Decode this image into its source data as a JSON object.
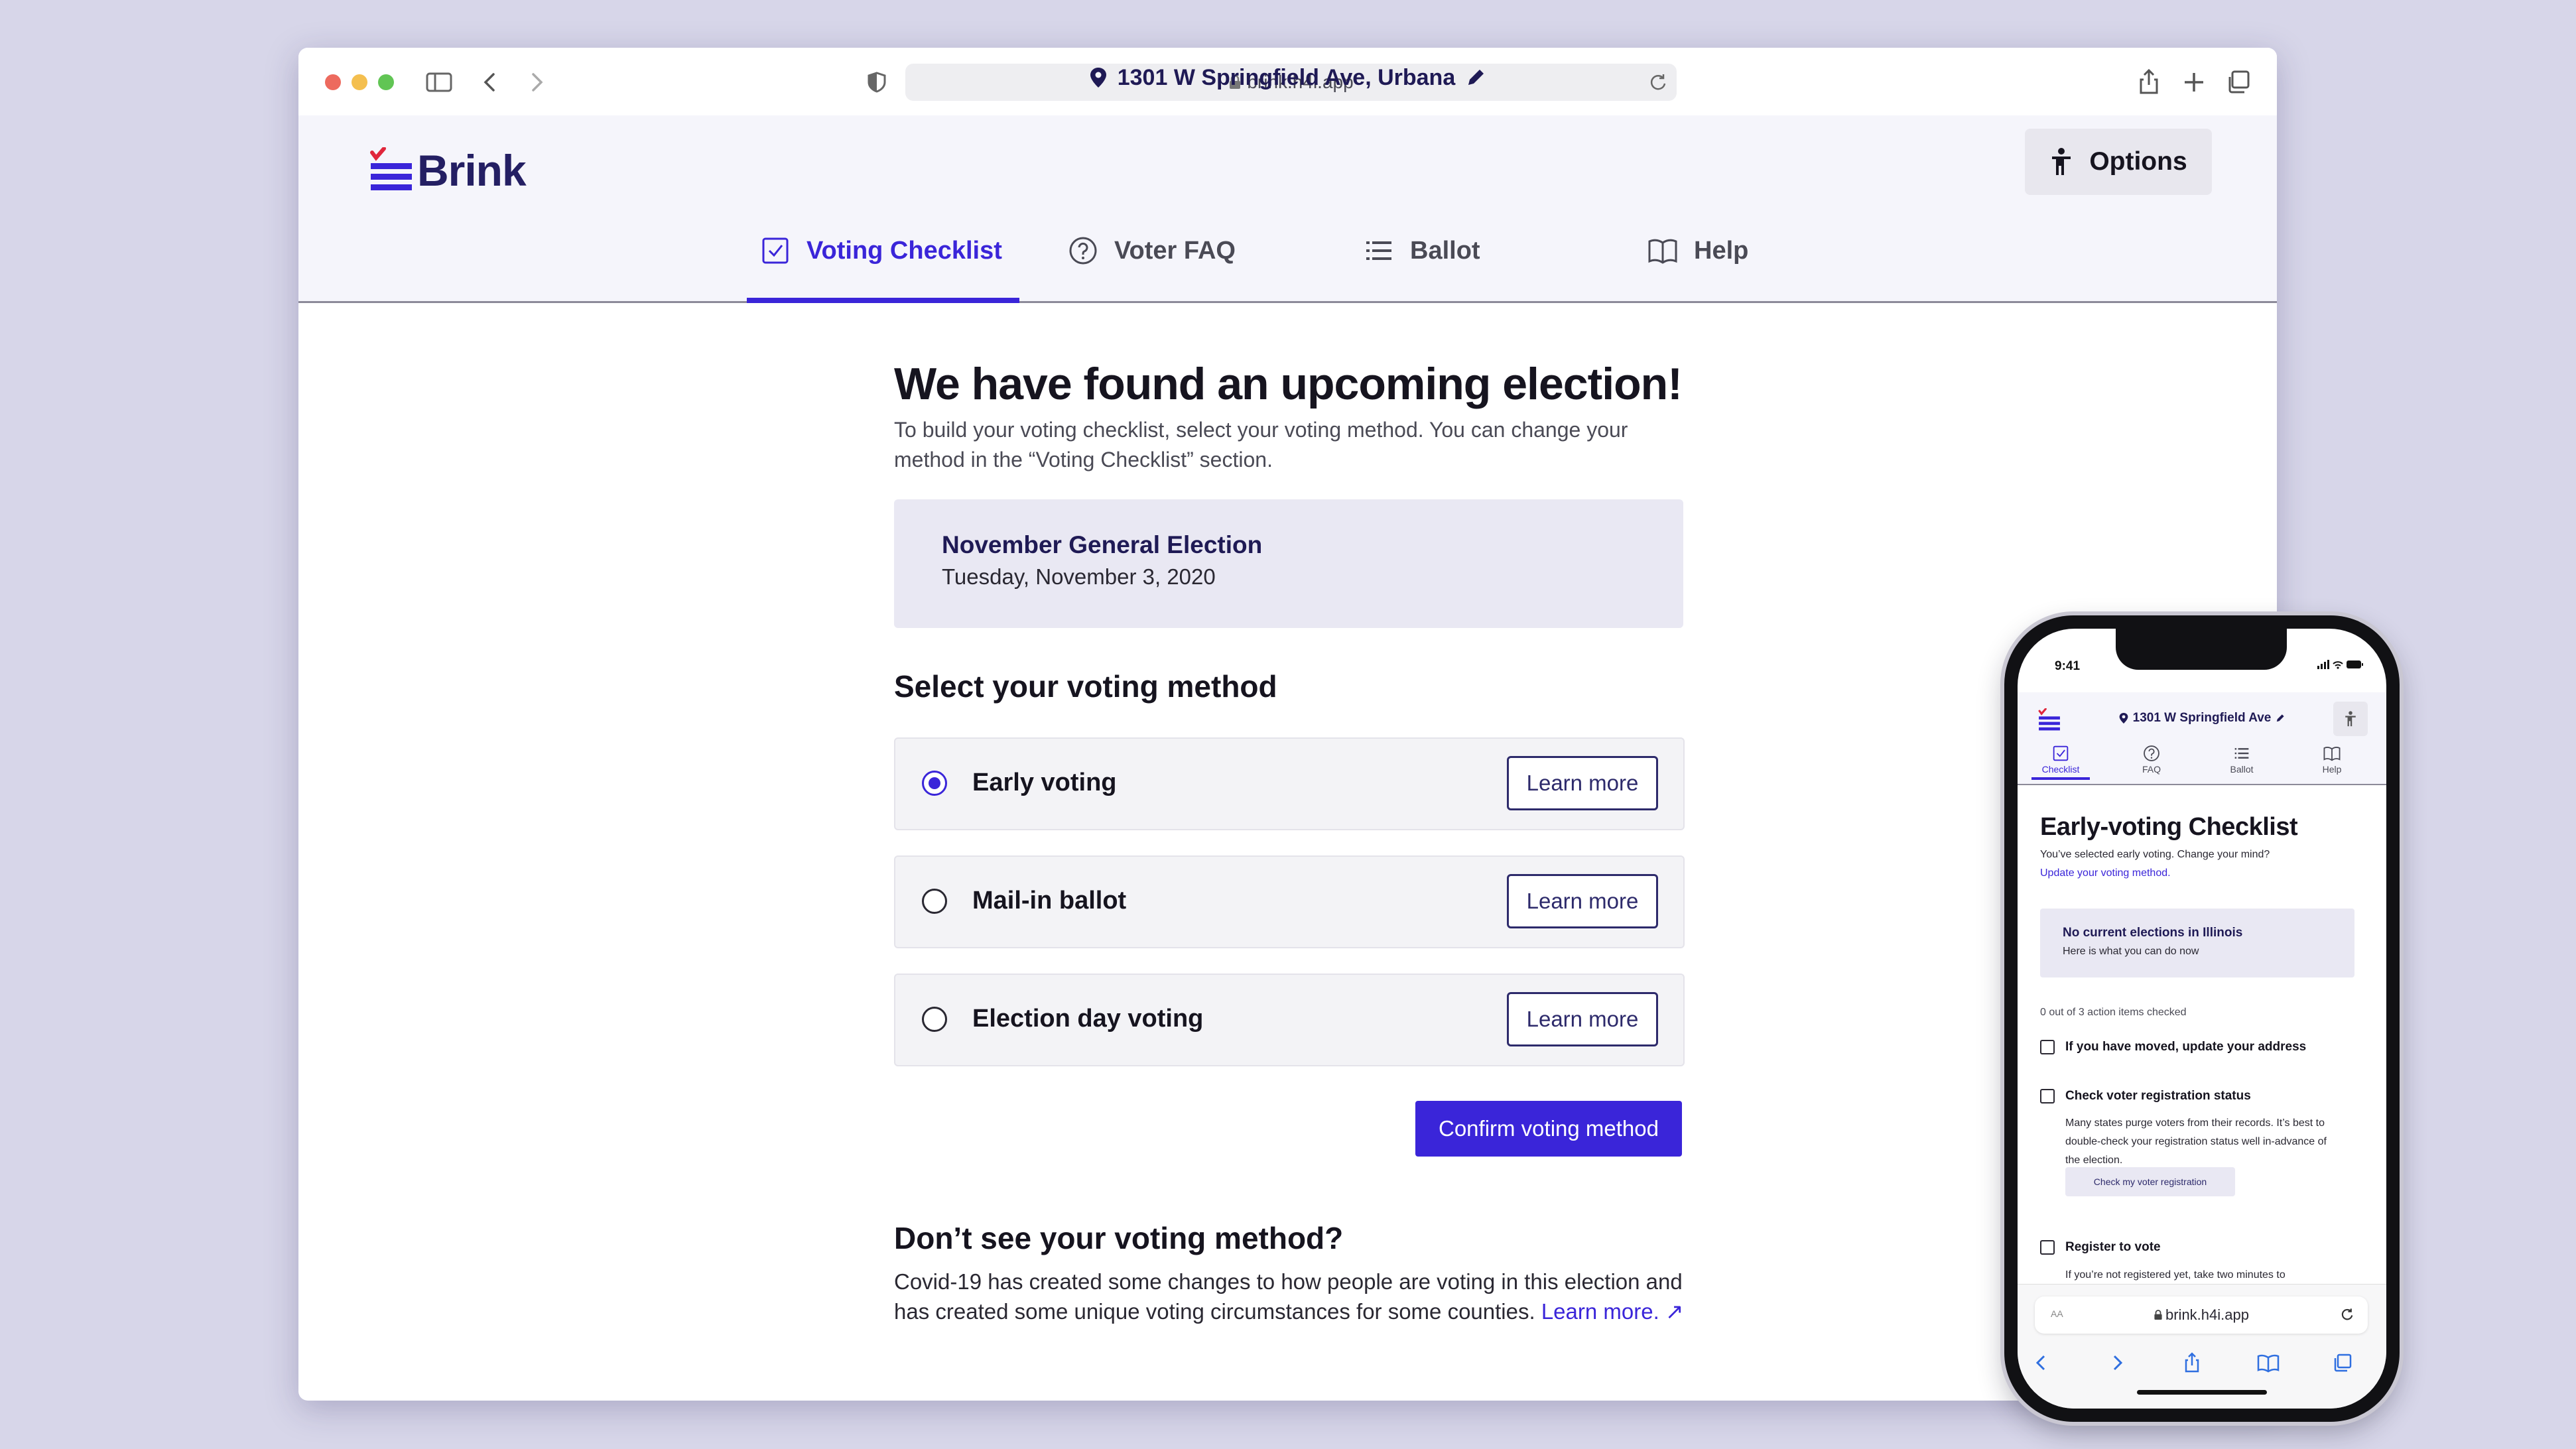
{
  "browser": {
    "url": "brink.h4i.app"
  },
  "app": {
    "brand": "Brink",
    "location": "1301 W Springfield Ave, Urbana",
    "options_label": "Options",
    "tabs": [
      {
        "label": "Voting Checklist",
        "active": true
      },
      {
        "label": "Voter FAQ",
        "active": false
      },
      {
        "label": "Ballot",
        "active": false
      },
      {
        "label": "Help",
        "active": false
      }
    ]
  },
  "main": {
    "title": "We have found an upcoming election!",
    "intro": "To build your voting checklist, select your voting method. You can change your method in the “Voting Checklist” section.",
    "election": {
      "name": "November General Election",
      "date": "Tuesday, November 3, 2020"
    },
    "select_heading": "Select your voting method",
    "methods": [
      {
        "label": "Early voting",
        "selected": true,
        "button": "Learn more"
      },
      {
        "label": "Mail-in ballot",
        "selected": false,
        "button": "Learn more"
      },
      {
        "label": "Election day voting",
        "selected": false,
        "button": "Learn more"
      }
    ],
    "confirm_label": "Confirm voting method",
    "missing_heading": "Don’t see your voting method?",
    "missing_text": "Covid-19 has created some changes to how people are voting in this election and has created some unique voting circumstances for some counties.",
    "missing_link": "Learn more. ↗"
  },
  "phone": {
    "time": "9:41",
    "location": "1301 W Springfield Ave",
    "tabs": [
      "Checklist",
      "FAQ",
      "Ballot",
      "Help"
    ],
    "title": "Early-voting Checklist",
    "subtitle": "You’ve selected early voting. Change your mind?",
    "update_link": "Update your voting method.",
    "card_title": "No current elections in Illinois",
    "card_text": "Here is what you can do now",
    "count": "0 out of 3 action items checked",
    "items": [
      "If you have moved, update your address",
      "Check voter registration status",
      "Register to vote"
    ],
    "item2_desc": "Many states purge voters from their records. It’s best to double-check your registration status well in-advance of the election.",
    "item2_button": "Check my voter registration",
    "item3_desc": "If you’re not registered yet, take two minutes to",
    "aa": "AA",
    "url": "brink.h4i.app"
  },
  "colors": {
    "accent": "#3a25d9",
    "navy": "#1f1a55",
    "brand_red": "#e0263b",
    "background": "#d7d6e9"
  }
}
